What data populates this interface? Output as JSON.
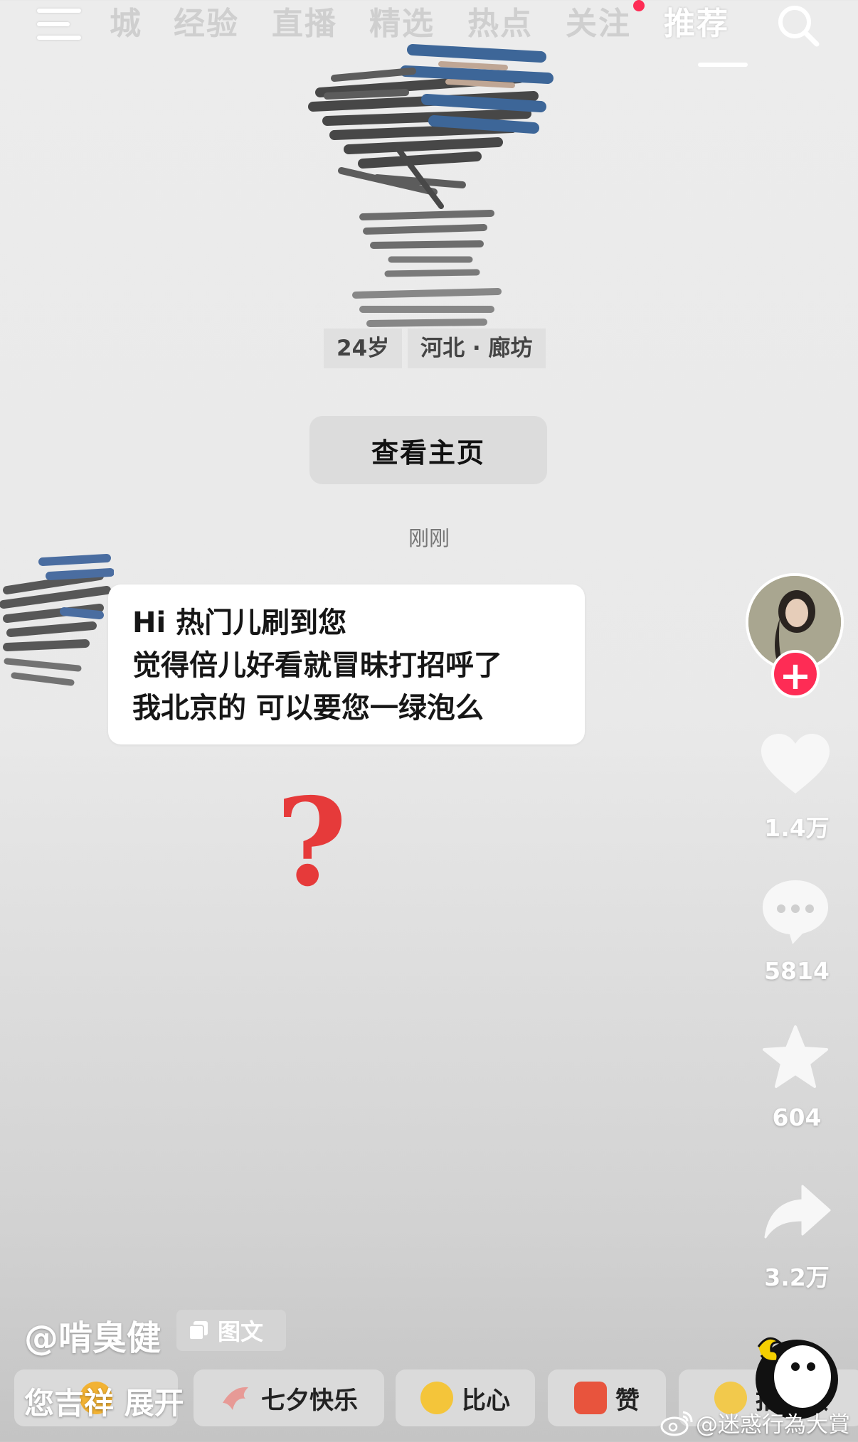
{
  "nav": {
    "tabs": [
      "城",
      "经验",
      "直播",
      "精选",
      "热点",
      "关注",
      "推荐"
    ],
    "active_tab": "推荐"
  },
  "profile_card": {
    "age": "24岁",
    "location": "河北 · 廊坊",
    "view_profile_label": "查看主页"
  },
  "chat": {
    "time": "刚刚",
    "message_lines": [
      "Hi 热门儿刷到您",
      "觉得倍儿好看就冒昧打招呼了",
      "我北京的 可以要您一绿泡么"
    ],
    "annotation": "?"
  },
  "sidebar": {
    "like_count": "1.4万",
    "comment_count": "5814",
    "favorite_count": "604",
    "share_count": "3.2万",
    "follow_symbol": "+"
  },
  "post": {
    "author": "@啃臭健",
    "type_label": "图文",
    "caption": "您吉祥 展开"
  },
  "quick_comments": [
    "七夕快乐",
    "比心",
    "赞",
    "拍同款"
  ],
  "watermark": "@迷惑行為大賞",
  "colors": {
    "accent_red": "#fe2c55",
    "annotation_red": "#e63a3a",
    "tab_inactive": "#cfcfcf",
    "tab_active": "#ffffff"
  }
}
